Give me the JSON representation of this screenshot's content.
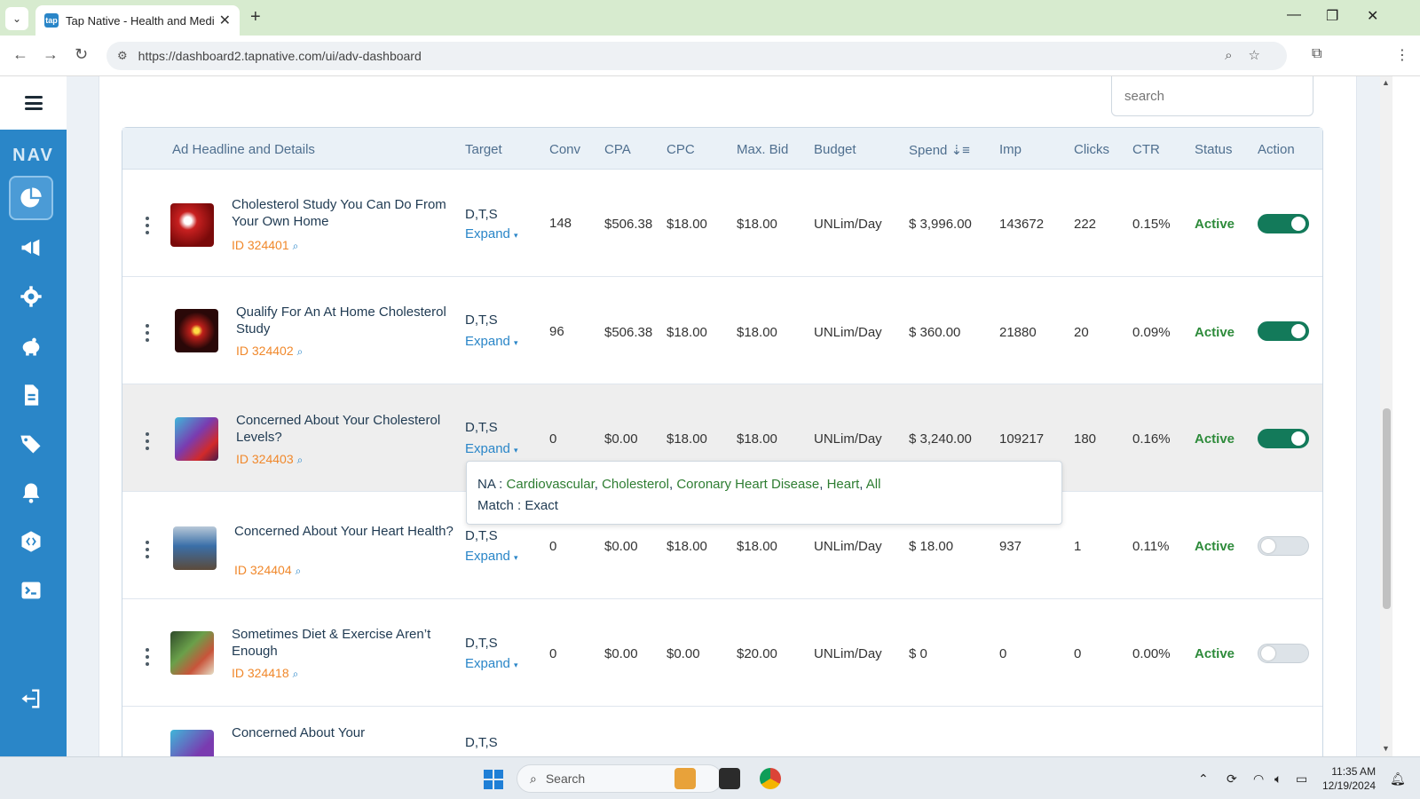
{
  "browser": {
    "tab_title": "Tap Native - Health and Medica",
    "tab_favicon": "tap",
    "url": "https://dashboard2.tapnative.com/ui/adv-dashboard"
  },
  "sidebar": {
    "nav_label": "NAV",
    "items": [
      {
        "name": "dashboard-icon",
        "active": true
      },
      {
        "name": "megaphone-icon",
        "active": false
      },
      {
        "name": "gear-icon",
        "active": false
      },
      {
        "name": "piggy-bank-icon",
        "active": false
      },
      {
        "name": "document-icon",
        "active": false
      },
      {
        "name": "tags-icon",
        "active": false
      },
      {
        "name": "bell-settings-icon",
        "active": false
      },
      {
        "name": "code-icon",
        "active": false
      },
      {
        "name": "terminal-icon",
        "active": false
      },
      {
        "name": "logout-icon",
        "active": false
      }
    ]
  },
  "search": {
    "placeholder": "search"
  },
  "table": {
    "headers": {
      "headline": "Ad Headline and Details",
      "target": "Target",
      "conv": "Conv",
      "cpa": "CPA",
      "cpc": "CPC",
      "maxbid": "Max. Bid",
      "budget": "Budget",
      "spend": "Spend",
      "imp": "Imp",
      "clicks": "Clicks",
      "ctr": "CTR",
      "status": "Status",
      "action": "Action"
    },
    "expand_label": "Expand",
    "rows": [
      {
        "headline": "Cholesterol Study You Can Do From Your Own Home",
        "id": "ID 324401",
        "target": "D,T,S",
        "conv": "148",
        "cpa": "$506.38",
        "cpc": "$18.00",
        "maxbid": "$18.00",
        "budget": "UNLim/Day",
        "spend": "$ 3,996.00",
        "imp": "143672",
        "clicks": "222",
        "ctr": "0.15%",
        "status": "Active",
        "enabled": true
      },
      {
        "headline": "Qualify For An At Home Cholesterol Study",
        "id": "ID 324402",
        "target": "D,T,S",
        "conv": "96",
        "cpa": "$506.38",
        "cpc": "$18.00",
        "maxbid": "$18.00",
        "budget": "UNLim/Day",
        "spend": "$ 360.00",
        "imp": "21880",
        "clicks": "20",
        "ctr": "0.09%",
        "status": "Active",
        "enabled": true
      },
      {
        "headline": "Concerned About Your Cholesterol Levels?",
        "id": "ID 324403",
        "target": "D,T,S",
        "conv": "0",
        "cpa": "$0.00",
        "cpc": "$18.00",
        "maxbid": "$18.00",
        "budget": "UNLim/Day",
        "spend": "$ 3,240.00",
        "imp": "109217",
        "clicks": "180",
        "ctr": "0.16%",
        "status": "Active",
        "enabled": true
      },
      {
        "headline": "Concerned About Your Heart Health?",
        "id": "ID 324404",
        "target": "D,T,S",
        "conv": "0",
        "cpa": "$0.00",
        "cpc": "$18.00",
        "maxbid": "$18.00",
        "budget": "UNLim/Day",
        "spend": "$ 18.00",
        "imp": "937",
        "clicks": "1",
        "ctr": "0.11%",
        "status": "Active",
        "enabled": false
      },
      {
        "headline": "Sometimes Diet & Exercise Aren’t Enough",
        "id": "ID 324418",
        "target": "D,T,S",
        "conv": "0",
        "cpa": "$0.00",
        "cpc": "$0.00",
        "maxbid": "$20.00",
        "budget": "UNLim/Day",
        "spend": "$ 0",
        "imp": "0",
        "clicks": "0",
        "ctr": "0.00%",
        "status": "Active",
        "enabled": false
      },
      {
        "headline": "Concerned About Your",
        "target": "D,T,S"
      }
    ]
  },
  "popover": {
    "na_label": "NA :",
    "keywords": [
      "Cardiovascular",
      "Cholesterol",
      "Coronary Heart Disease",
      "Heart",
      "All"
    ],
    "match_text": "Match : Exact"
  },
  "taskbar": {
    "search_placeholder": "Search",
    "time": "11:35 AM",
    "date": "12/19/2024"
  },
  "colors": {
    "brand_blue": "#2a86c8",
    "active_green": "#2e8b3b",
    "toggle_on": "#137a5a",
    "id_orange": "#f0882b"
  }
}
